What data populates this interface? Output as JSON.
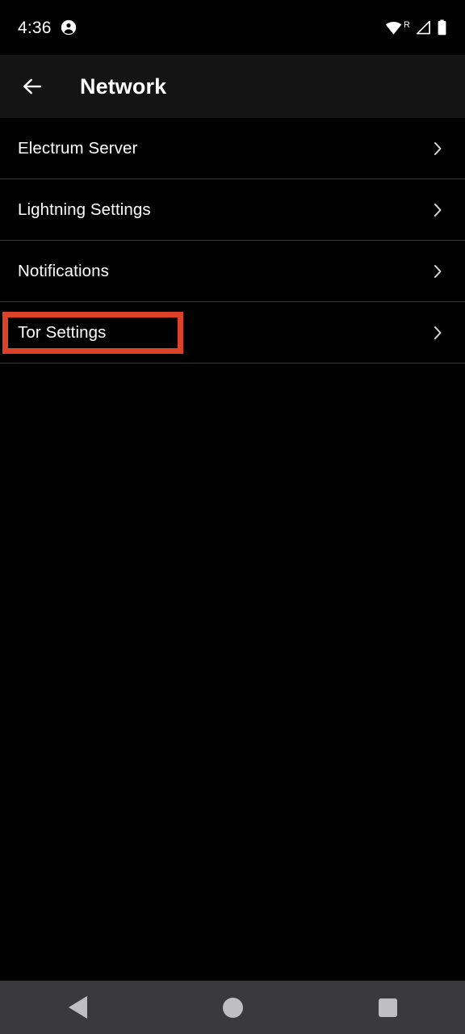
{
  "status_bar": {
    "time": "4:36",
    "account_icon": "account-circle-icon",
    "wifi_icon": "wifi-icon",
    "roaming_label": "R",
    "signal_icon": "cellular-signal-icon",
    "battery_icon": "battery-full-icon"
  },
  "app_bar": {
    "back_icon": "arrow-back-icon",
    "title": "Network"
  },
  "list": {
    "chevron_icon": "chevron-right-icon",
    "items": [
      {
        "label": "Electrum Server",
        "highlighted": false
      },
      {
        "label": "Lightning Settings",
        "highlighted": false
      },
      {
        "label": "Notifications",
        "highlighted": false
      },
      {
        "label": "Tor Settings",
        "highlighted": true
      }
    ]
  },
  "highlight": {
    "color": "#dc4228",
    "target": "Tor Settings"
  },
  "nav_bar": {
    "back_label": "Back",
    "home_label": "Home",
    "recents_label": "Recent apps"
  },
  "colors": {
    "background": "#000000",
    "app_bar_background": "#141414",
    "divider": "#3a3a3a",
    "text_primary": "#ffffff",
    "nav_background": "#3a3a3c",
    "nav_icon": "#bfbfbf",
    "accent_highlight": "#dc4228"
  }
}
